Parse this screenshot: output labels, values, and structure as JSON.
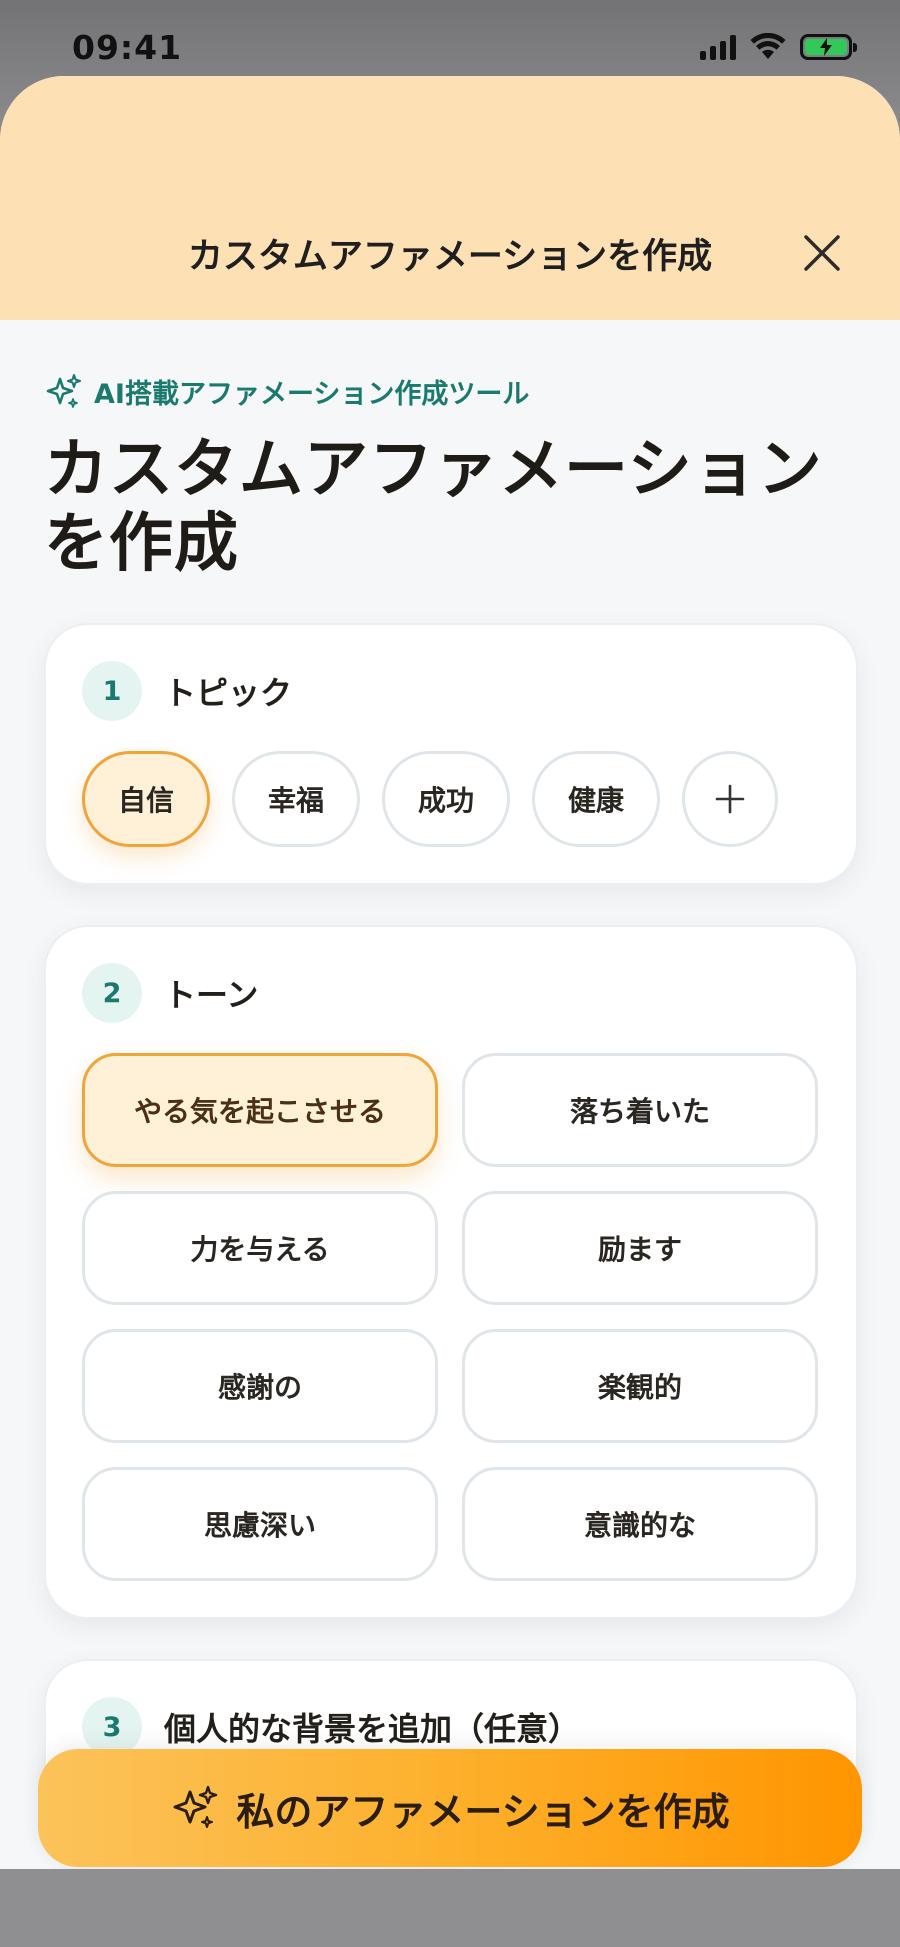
{
  "status_bar": {
    "time": "09:41"
  },
  "sheet": {
    "header_title": "カスタムアファメーションを作成"
  },
  "intro": {
    "tag": "AI搭載アファメーション作成ツール",
    "title": "カスタムアファメーションを作成"
  },
  "step1": {
    "number": "1",
    "title": "トピック",
    "topics": [
      "自信",
      "幸福",
      "成功",
      "健康"
    ],
    "selected": "自信",
    "add_label": "+"
  },
  "step2": {
    "number": "2",
    "title": "トーン",
    "tones": [
      "やる気を起こさせる",
      "落ち着いた",
      "力を与える",
      "励ます",
      "感謝の",
      "楽観的",
      "思慮深い",
      "意識的な"
    ],
    "selected": "やる気を起こさせる"
  },
  "step3": {
    "number": "3",
    "title": "個人的な背景を追加（任意）"
  },
  "cta": {
    "label": "私のアファメーションを作成"
  },
  "colors": {
    "header_bg": "#fde0b4",
    "accent_teal": "#1b7a6e",
    "selected_bg": "#fff0d8",
    "selected_border": "#f0a43a",
    "cta_start": "#fcc35a",
    "cta_end": "#ff9500"
  },
  "icons": {
    "close": "close-icon",
    "sparkle": "sparkles-icon",
    "signal": "signal-icon",
    "wifi": "wifi-icon",
    "battery": "battery-charging-icon"
  }
}
